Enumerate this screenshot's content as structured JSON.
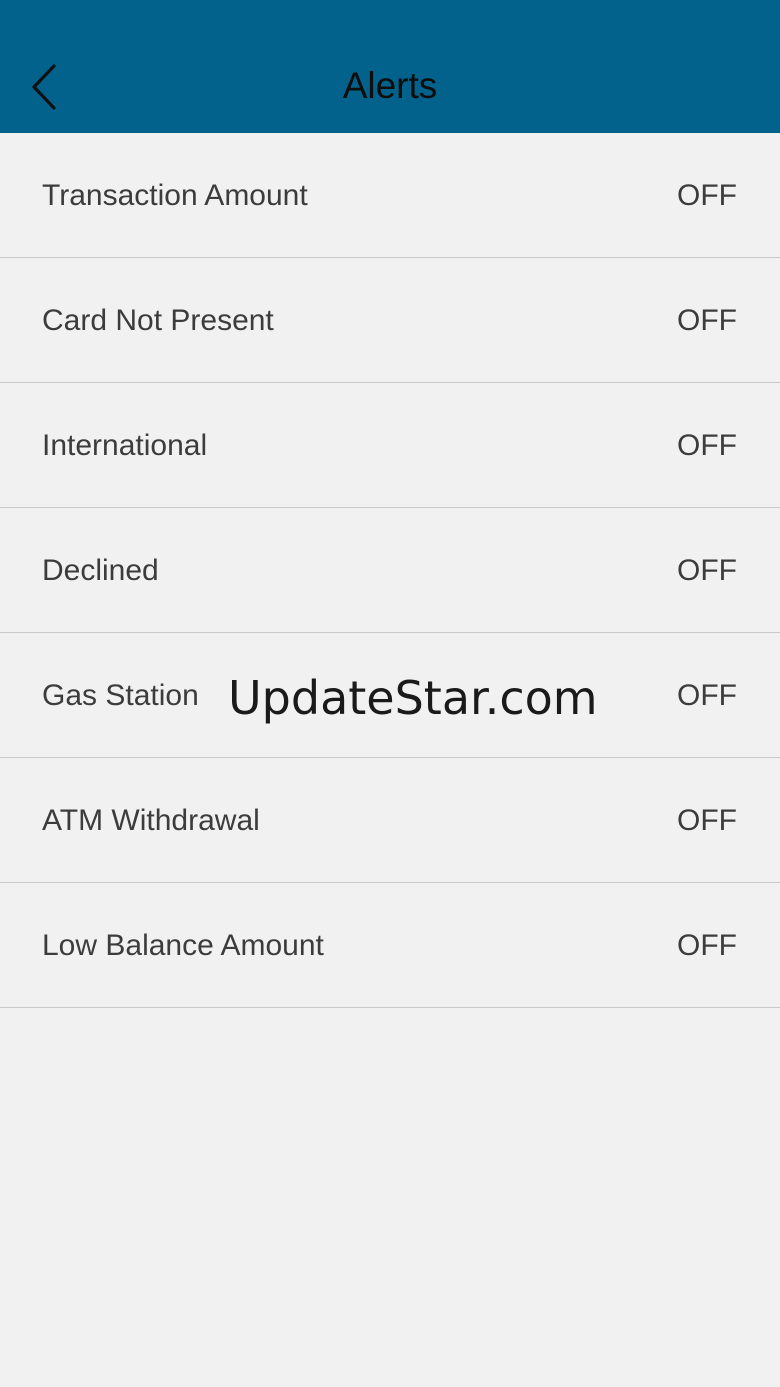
{
  "header": {
    "title": "Alerts",
    "back_icon": "chevron-left-icon",
    "background_color": "#02628c"
  },
  "alerts": [
    {
      "label": "Transaction Amount",
      "value": "OFF"
    },
    {
      "label": "Card Not Present",
      "value": "OFF"
    },
    {
      "label": "International",
      "value": "OFF"
    },
    {
      "label": "Declined",
      "value": "OFF"
    },
    {
      "label": "Gas Station",
      "value": "OFF"
    },
    {
      "label": "ATM Withdrawal",
      "value": "OFF"
    },
    {
      "label": "Low Balance Amount",
      "value": "OFF"
    }
  ],
  "watermark": "UpdateStar.com"
}
